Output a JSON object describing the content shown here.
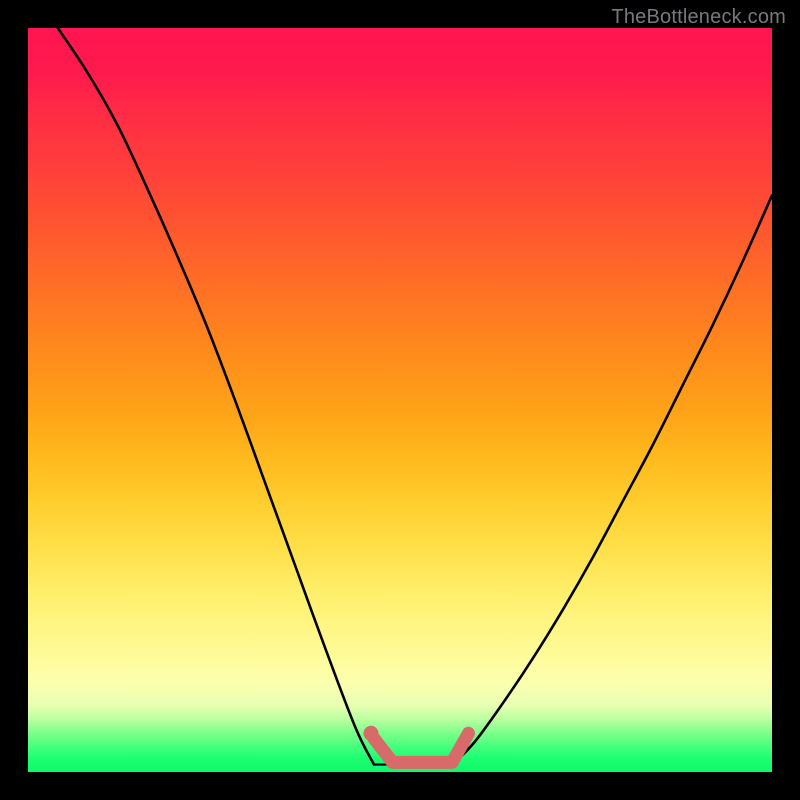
{
  "watermark": "TheBottleneck.com",
  "colors": {
    "bg": "#000000",
    "gradient_top": "#ff1552",
    "gradient_bottom": "#0dfa68",
    "curve_stroke": "#000000",
    "marker_stroke": "#d86a6a",
    "marker_fill": "#d86a6a"
  },
  "chart_data": {
    "type": "line",
    "title": "",
    "xlabel": "",
    "ylabel": "",
    "xlim": [
      0,
      100
    ],
    "ylim": [
      0,
      100
    ],
    "grid": false,
    "curve_left": {
      "x": [
        4,
        8,
        12,
        16,
        20,
        24,
        28,
        32,
        36,
        40,
        44,
        46.5
      ],
      "y": [
        100,
        94,
        87,
        78.5,
        69.5,
        60,
        49.5,
        38.5,
        27.5,
        16.5,
        6,
        1
      ]
    },
    "curve_right": {
      "x": [
        57,
        60,
        64,
        68,
        72,
        76,
        80,
        84,
        88,
        92,
        96,
        100
      ],
      "y": [
        1,
        4,
        9.5,
        15.5,
        22,
        29,
        36.5,
        44,
        52,
        60,
        68.5,
        77.5
      ]
    },
    "flat_minimum": {
      "x": [
        46.5,
        57
      ],
      "y": [
        1,
        1
      ]
    },
    "annotation_segment": {
      "start": {
        "x": 46.5,
        "y": 4.5
      },
      "flat_start": {
        "x": 49,
        "y": 1.3
      },
      "flat_end": {
        "x": 57,
        "y": 1.3
      },
      "end": {
        "x": 59.2,
        "y": 5.2
      }
    },
    "annotation_dot": {
      "x": 46.1,
      "y": 5.2
    }
  }
}
